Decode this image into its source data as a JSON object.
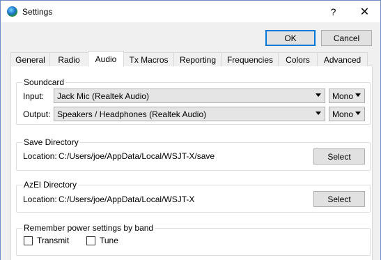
{
  "window": {
    "title": "Settings",
    "help_glyph": "?",
    "close_glyph": "✕",
    "app_icon": "globe-icon"
  },
  "dialog_buttons": {
    "ok": "OK",
    "cancel": "Cancel"
  },
  "tabs": [
    {
      "label": "General",
      "active": false
    },
    {
      "label": "Radio",
      "active": false
    },
    {
      "label": "Audio",
      "active": true
    },
    {
      "label": "Tx Macros",
      "active": false
    },
    {
      "label": "Reporting",
      "active": false
    },
    {
      "label": "Frequencies",
      "active": false
    },
    {
      "label": "Colors",
      "active": false
    },
    {
      "label": "Advanced",
      "active": false
    }
  ],
  "soundcard": {
    "title": "Soundcard",
    "input_label": "Input:",
    "input_device": "Jack Mic (Realtek Audio)",
    "input_channel": "Mono",
    "output_label": "Output:",
    "output_device": "Speakers / Headphones (Realtek Audio)",
    "output_channel": "Mono"
  },
  "save_directory": {
    "title": "Save Directory",
    "location_label": "Location:",
    "path": "C:/Users/joe/AppData/Local/WSJT-X/save",
    "select_label": "Select"
  },
  "azel_directory": {
    "title": "AzEl Directory",
    "location_label": "Location:",
    "path": "C:/Users/joe/AppData/Local/WSJT-X",
    "select_label": "Select"
  },
  "power_settings": {
    "title": "Remember power settings by band",
    "transmit_label": "Transmit",
    "transmit_checked": false,
    "tune_label": "Tune",
    "tune_checked": false
  }
}
